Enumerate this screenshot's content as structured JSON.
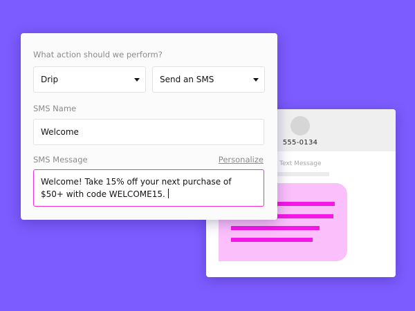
{
  "form": {
    "question": "What action should we perform?",
    "action_type": {
      "selected": "Drip"
    },
    "action": {
      "selected": "Send an SMS"
    },
    "sms_name": {
      "label": "SMS Name",
      "value": "Welcome"
    },
    "sms_message": {
      "label": "SMS Message",
      "personalize_link": "Personalize",
      "value": "Welcome! Take 15%  off your next purchase of $50+ with code WELCOME15."
    }
  },
  "preview": {
    "contact_number": "555-0134",
    "message_label": "Text Message"
  },
  "colors": {
    "background": "#7c5cff",
    "accent_magenta": "#ef2fe6",
    "bubble_fill": "#fbc0fb",
    "bubble_lines": "#f516e8"
  },
  "icons": {
    "select_caret": "caret-down-icon"
  }
}
